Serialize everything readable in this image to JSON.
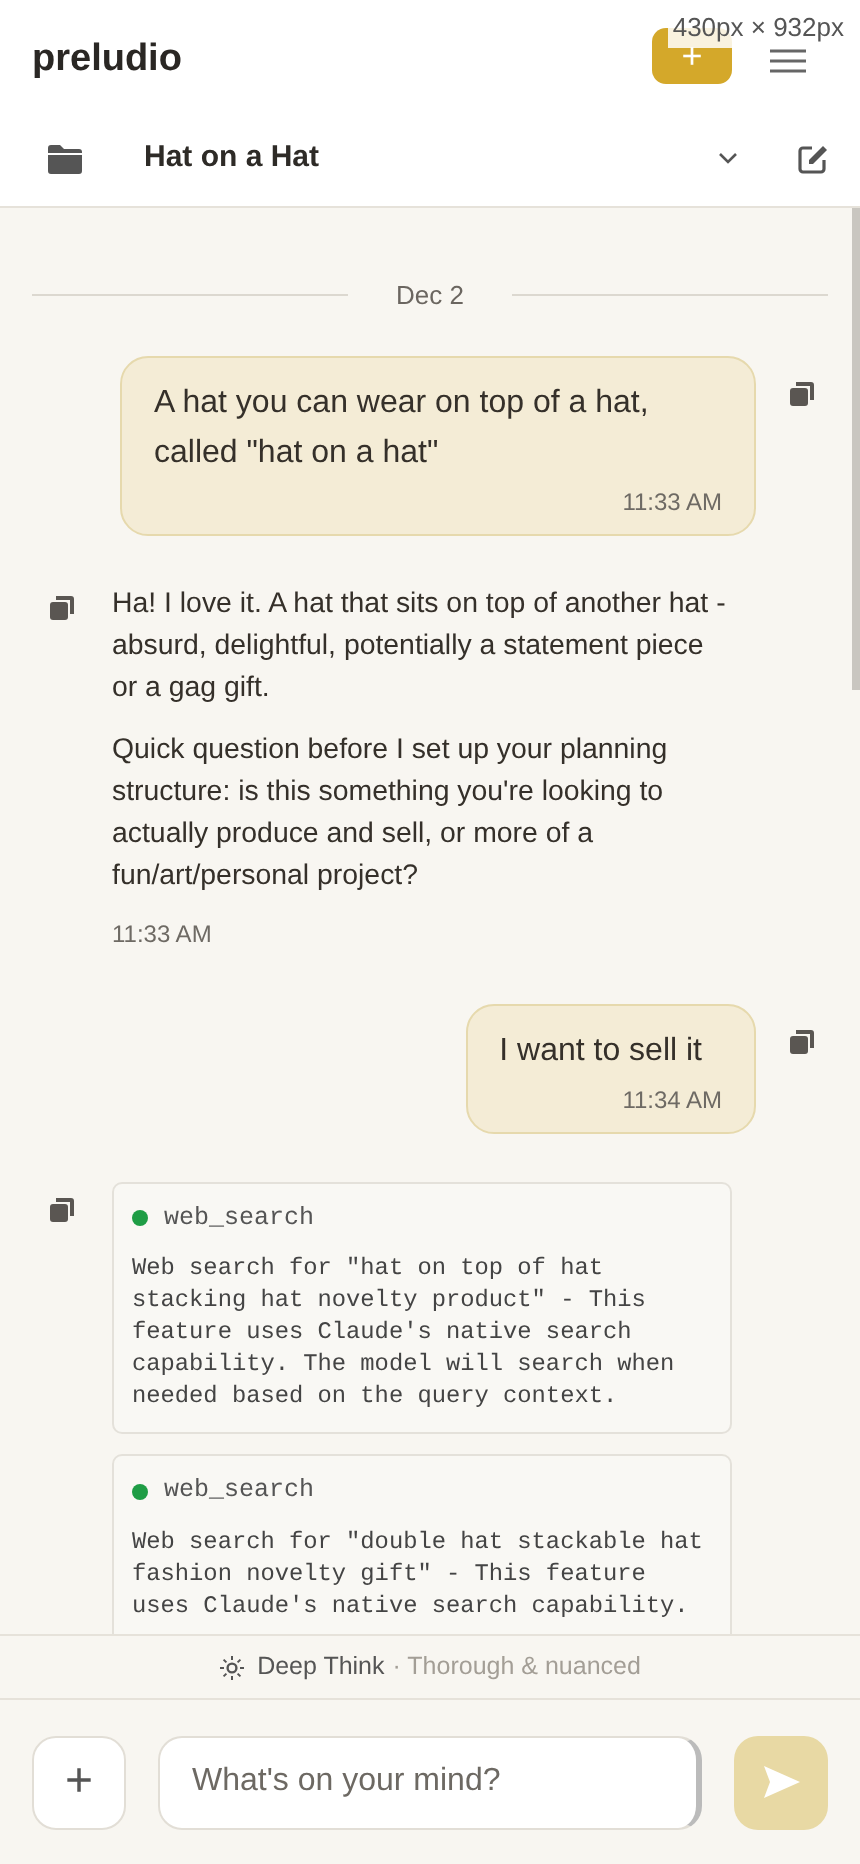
{
  "app": {
    "name": "preludio",
    "viewport_size": "430px × 932px",
    "new_button": "+"
  },
  "project": {
    "title": "Hat on a Hat"
  },
  "date_divider": "Dec 2",
  "messages": [
    {
      "kind": "user",
      "paragraphs": [
        "A hat you can wear on top of a hat, called \"hat on a hat\""
      ],
      "time": "11:33 AM"
    },
    {
      "kind": "assistant",
      "paragraphs": [
        "Ha! I love it. A hat that sits on top of another hat - absurd, delightful, potentially a statement piece or a gag gift.",
        "Quick question before I set up your planning structure: is this something you're looking to actually produce and sell, or more of a fun/art/personal project?"
      ],
      "time": "11:33 AM"
    },
    {
      "kind": "user",
      "paragraphs": [
        "I want to sell it"
      ],
      "time": "11:34 AM"
    },
    {
      "kind": "tools",
      "calls": [
        {
          "name": "web_search",
          "color": "#1f9d45",
          "text": "Web search for \"hat on top of hat stacking hat novelty product\" - This feature uses Claude's native search capability. The model will search when needed based on the query context."
        },
        {
          "name": "web_search",
          "color": "#1f9d45",
          "text": "Web search for \"double hat stackable hat fashion novelty gift\" - This feature uses Claude's native search capability."
        }
      ]
    }
  ],
  "mode": {
    "name": "Deep Think",
    "detail": "· Thorough & nuanced"
  },
  "composer": {
    "attach": "+",
    "placeholder": "What's on your mind?"
  }
}
